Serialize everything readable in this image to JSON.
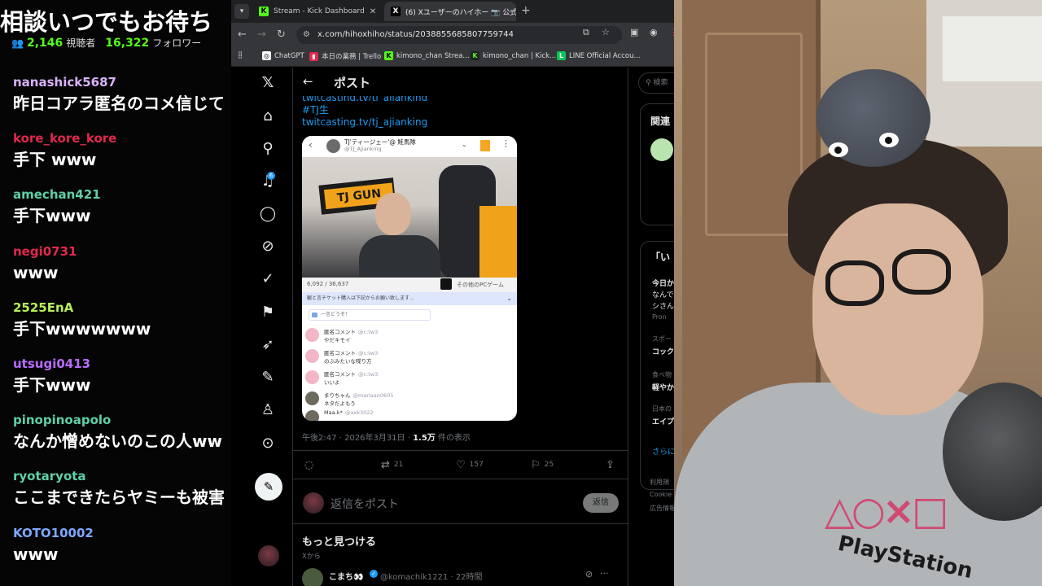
{
  "stream_overlay": {
    "banner_text": "相談いつでもお待ち",
    "viewers_count": "2,146",
    "viewers_label": "視聴者",
    "followers_count": "16,322",
    "followers_label": "フォロワー",
    "messages": [
      {
        "user": "nanashick5687",
        "color": "#d9b3ff",
        "text": "昨日コアラ匿名のコメ信じて"
      },
      {
        "user": "kore_kore_kore",
        "color": "#e0294d",
        "text": "手下 www"
      },
      {
        "user": "amechan421",
        "color": "#5fd0a8",
        "text": "手下www"
      },
      {
        "user": "negi0731",
        "color": "#e0294d",
        "text": "www"
      },
      {
        "user": "2525EnA",
        "color": "#b6f05a",
        "text": "手下wwwwwww"
      },
      {
        "user": "utsugi0413",
        "color": "#b86cff",
        "text": "手下www"
      },
      {
        "user": "pinopinoapolo",
        "color": "#5fd0a8",
        "text": "なんか憎めないのこの人ww"
      },
      {
        "user": "ryotaryota",
        "color": "#5fd0a8",
        "text": "ここまできたらヤミーも被害"
      },
      {
        "user": "KOTO10002",
        "color": "#7fa8ff",
        "text": "www"
      }
    ]
  },
  "browser": {
    "tabs": [
      {
        "title": "Stream - Kick Dashboard",
        "favicon": "K",
        "favicon_color": "#53fc18",
        "active": false
      },
      {
        "title": "(6) Xユーザーのハイホー 📷 公式",
        "favicon": "X",
        "favicon_color": "#ffffff",
        "active": true
      }
    ],
    "url": "x.com/hihoxhiho/status/2038855685807759744",
    "bookmarks": [
      {
        "label": "ChatGPT",
        "favicon": "◎",
        "color": "#ffffff"
      },
      {
        "label": "本日の業務 | Trello",
        "favicon": "▮",
        "color": "#e0294d"
      },
      {
        "label": "kimono_chan Strea...",
        "favicon": "K",
        "color": "#53fc18"
      },
      {
        "label": "kimono_chan | Kick...",
        "favicon": "K",
        "color": "#53fc18"
      },
      {
        "label": "LINE Official Accou...",
        "favicon": "L",
        "color": "#06c755"
      }
    ]
  },
  "x": {
    "nav_icons": [
      "x-logo-icon",
      "home-icon",
      "search-icon",
      "bell-icon",
      "message-icon",
      "grok-icon",
      "verified-icon",
      "bookmark-icon",
      "rocket-icon",
      "edit-note-icon",
      "profile-icon",
      "more-icon"
    ],
    "notification_badge": "6",
    "header_title": "ポスト",
    "hashtag": "#TJ生",
    "link": "twitcasting.tv/tj_ajianking",
    "shot": {
      "account_name": "TJ'ティージェー'@ 鮭馬隊",
      "account_handle": "@TJ_Ajianking",
      "banner_text": "TJ GUN",
      "view_stats": "6,092 / 36,637",
      "category": "その他のPCゲーム",
      "notice": "観と言チケット購入は下記からお願い致します...",
      "chat_prompt": "一言どうぞ！",
      "comments": [
        {
          "name": "匿名コメント",
          "handle": "@c:tw3",
          "text": "やだキモイ",
          "icon": "pink"
        },
        {
          "name": "匿名コメント",
          "handle": "@c:tw3",
          "text": "のぶみたいな喋り方",
          "icon": "pink"
        },
        {
          "name": "匿名コメント",
          "handle": "@c:tw3",
          "text": "いいよ",
          "icon": "pink"
        },
        {
          "name": "まりちゃん",
          "handle": "@mariaan0605",
          "text": "ネタだよもう",
          "icon": "dark"
        },
        {
          "name": "Maa-k*",
          "handle": "@axk3022",
          "text": "",
          "icon": "dark"
        }
      ]
    },
    "timestamp": "午後2:47 · 2026年3月31日 · ",
    "views_count": "1.5万",
    "views_label": " 件の表示",
    "actions": {
      "reply": "",
      "retweets": "21",
      "likes": "157",
      "bookmarks": "25"
    },
    "reply_placeholder": "返信をポスト",
    "reply_button": "返信",
    "more_title": "もっと見つける",
    "more_subtitle": "Xから",
    "next_post": {
      "name": "こまち👀",
      "handle": "@komachik1221 · 22時間"
    },
    "sidebar": {
      "search_placeholder": "検索",
      "related_title": "関連",
      "trends_title": "「い",
      "trend_1_bold": "今日か",
      "trend_1_text": "なんで",
      "trend_1_text2": "シさん",
      "trend_1_promo": "Pron",
      "trend_2_small": "スポー",
      "trend_2_bold": "コック",
      "trend_3_small": "食べ物",
      "trend_3_bold": "軽やか",
      "trend_4_small": "日本の",
      "trend_4_bold": "エイプ",
      "show_more": "さらに",
      "footer_1": "利用規",
      "footer_2": "Cookie",
      "footer_3": "広告情報"
    }
  },
  "webcam": {
    "shirt_logo": "△○×□",
    "shirt_brand": "PlayStation"
  }
}
